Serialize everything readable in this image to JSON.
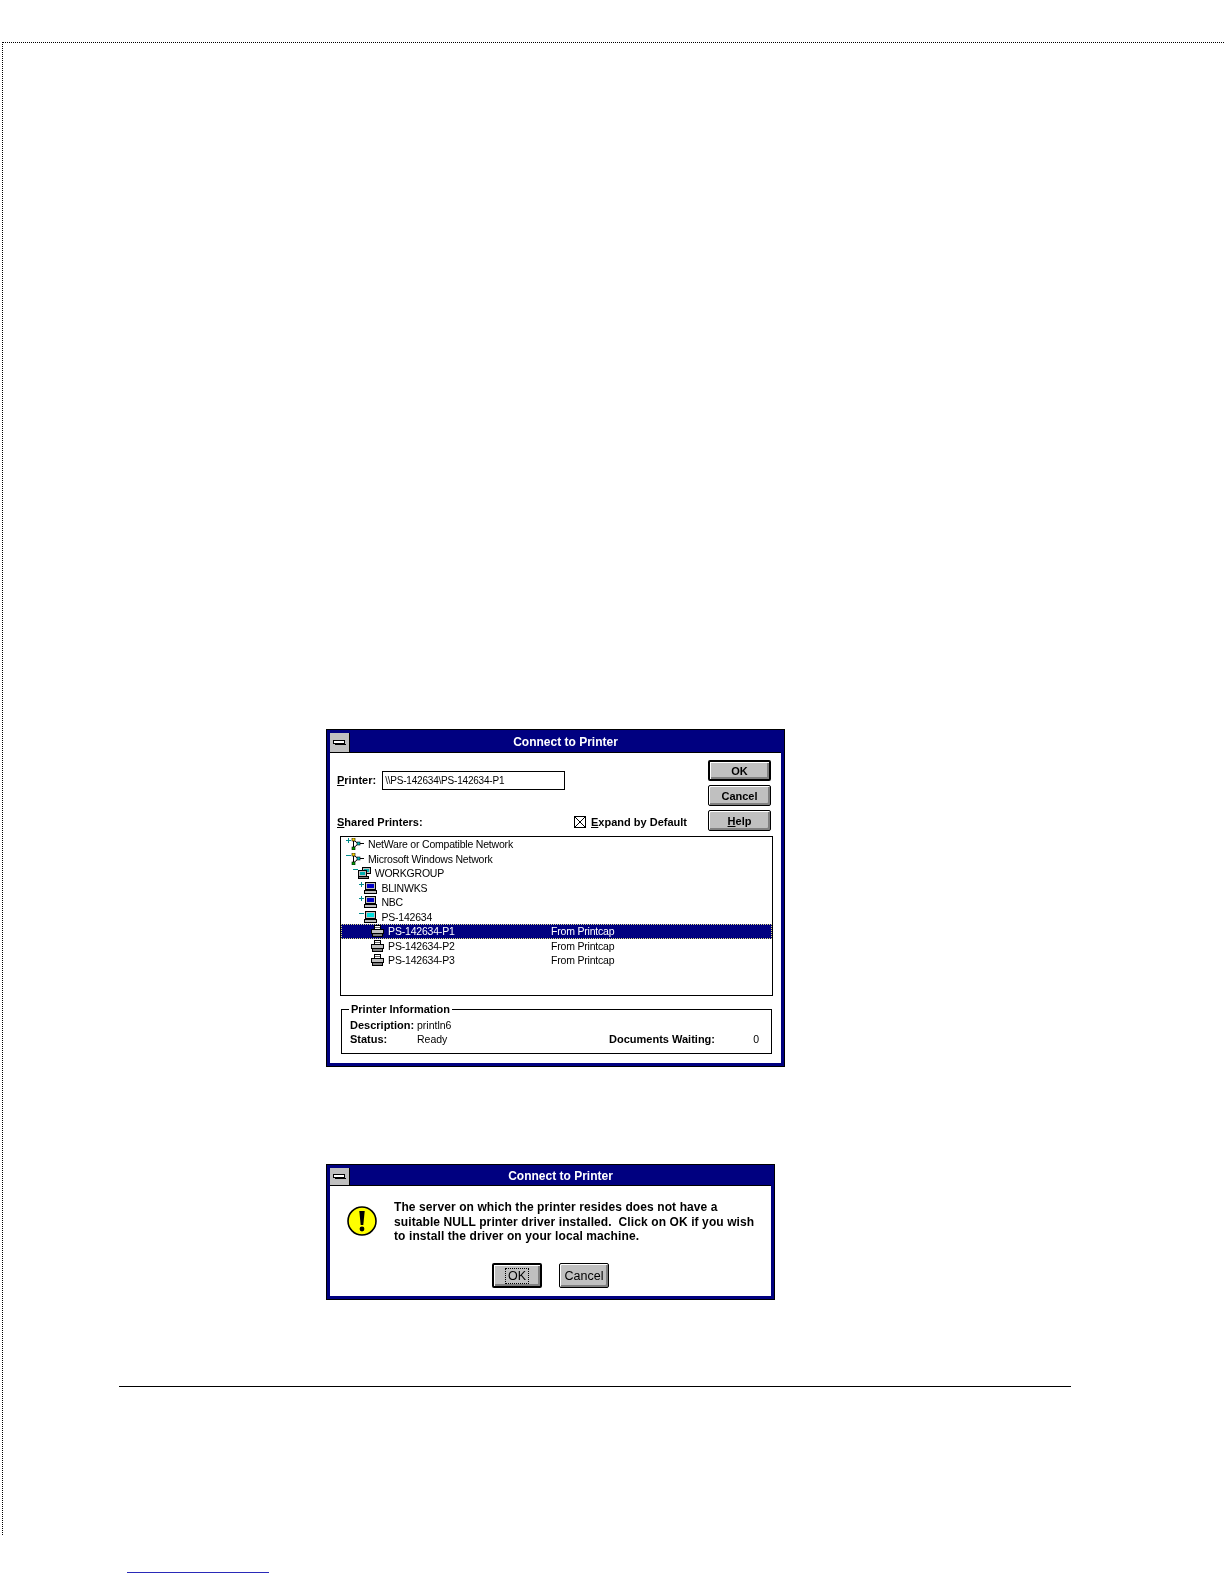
{
  "dialogs": [
    {
      "kind": "connect",
      "title": "Connect to Printer",
      "printer_field": {
        "label": "Printer:",
        "underline_first": true,
        "value": "\\\\PS-142634\\PS-142634-P1"
      },
      "buttons": [
        {
          "label": "OK",
          "default": true,
          "underline_first": false
        },
        {
          "label": "Cancel",
          "default": false,
          "underline_first": false
        },
        {
          "label": "Help",
          "default": false,
          "underline_first": true
        }
      ],
      "shared_printers": {
        "label": "Shared Printers:",
        "underline_first": true
      },
      "expand_checkbox": {
        "label": "Expand by Default",
        "underline_first": true,
        "checked": true
      },
      "tree": [
        {
          "kind": "network",
          "name": "NetWare or Compatible Network",
          "expanded": false,
          "selected": false
        },
        {
          "kind": "network",
          "name": "Microsoft Windows Network",
          "expanded": true,
          "selected": false,
          "children": [
            {
              "kind": "workgroup",
              "name": "WORKGROUP",
              "expanded": true,
              "selected": false,
              "children": [
                {
                  "kind": "computer",
                  "name": "BLINWKS",
                  "expanded": false,
                  "selected": false
                },
                {
                  "kind": "computer",
                  "name": "NBC",
                  "expanded": false,
                  "selected": false
                },
                {
                  "kind": "computer",
                  "name": "PS-142634",
                  "expanded": true,
                  "selected": false,
                  "children": [
                    {
                      "kind": "printer",
                      "name": "PS-142634-P1",
                      "comment": "From Printcap",
                      "selected": true
                    },
                    {
                      "kind": "printer",
                      "name": "PS-142634-P2",
                      "comment": "From Printcap",
                      "selected": false
                    },
                    {
                      "kind": "printer",
                      "name": "PS-142634-P3",
                      "comment": "From Printcap",
                      "selected": false
                    }
                  ]
                }
              ]
            }
          ]
        }
      ],
      "printer_information": {
        "title": "Printer Information",
        "description_label": "Description:",
        "description": "println6",
        "status_label": "Status:",
        "status": "Ready",
        "documents_waiting_label": "Documents Waiting:",
        "documents_waiting": "0"
      }
    },
    {
      "kind": "message",
      "title": "Connect to Printer",
      "message": "The server on which the printer resides does not have a\nsuitable NULL printer driver installed.  Click on OK if you wish\nto install the driver on your local machine.",
      "buttons": [
        {
          "label": "OK",
          "default": true,
          "focused": true
        },
        {
          "label": "Cancel",
          "default": false,
          "focused": false
        }
      ]
    }
  ]
}
